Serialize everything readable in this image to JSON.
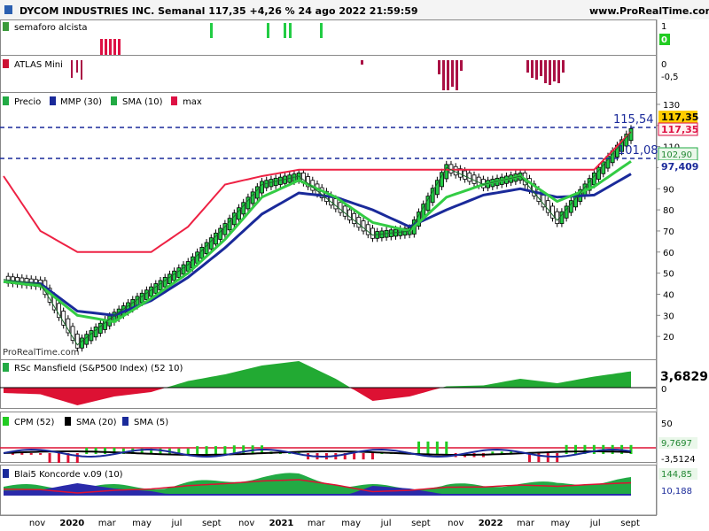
{
  "header": {
    "title": "DYCOM INDUSTRIES INC. Semanal 117,35 +4,26 % 24 ago 2022 21:59:59",
    "site": "www.ProRealTime.com"
  },
  "watermark": "ProRealTime.com",
  "panels": {
    "semaforo": {
      "label": "semaforo alcista",
      "axis": [
        "1",
        "0"
      ],
      "badge": "0"
    },
    "atlas": {
      "label": "ATLAS Mini",
      "axis": [
        "0",
        "-0,5"
      ]
    },
    "price": {
      "legend": [
        {
          "label": "Precio",
          "color": "#22aa44"
        },
        {
          "label": "MMP (30)",
          "color": "#1a2a9a"
        },
        {
          "label": "SMA (10)",
          "color": "#22aa44"
        },
        {
          "label": "max",
          "color": "#dd1144"
        }
      ],
      "annot_high": "115,54",
      "annot_low": "101,08",
      "yticks": [
        "130",
        "120",
        "110",
        "100",
        "90",
        "80",
        "70",
        "60",
        "50",
        "40",
        "30",
        "20"
      ],
      "badges": {
        "price": "117,35",
        "max": "117,35",
        "level": "102,90",
        "mmp": "97,409"
      }
    },
    "rsc": {
      "label": "RSc Mansfield (S&P500 Index) (52 10)",
      "value": "3,6829",
      "axis": [
        "0"
      ]
    },
    "cpm": {
      "legend": [
        {
          "label": "CPM (52)",
          "color": "#22cc22"
        },
        {
          "label": "SMA (20)",
          "color": "#000000"
        },
        {
          "label": "SMA (5)",
          "color": "#1a2a9a"
        }
      ],
      "axis": [
        "50"
      ],
      "badges": [
        "9,7697",
        "-3,5124"
      ]
    },
    "koncorde": {
      "label": "Blai5 Koncorde v.09 (10)",
      "badges": [
        "144,85",
        "10,188"
      ]
    }
  },
  "xaxis": [
    "nov",
    "2020",
    "mar",
    "may",
    "jul",
    "sept",
    "nov",
    "2021",
    "mar",
    "may",
    "jul",
    "sept",
    "nov",
    "2022",
    "mar",
    "may",
    "jul",
    "sept"
  ],
  "chart_data": [
    {
      "type": "line",
      "title": "DYCOM INDUSTRIES INC. Semanal",
      "x": [
        "2019-11",
        "2020-01",
        "2020-03",
        "2020-05",
        "2020-07",
        "2020-09",
        "2020-11",
        "2021-01",
        "2021-03",
        "2021-05",
        "2021-07",
        "2021-09",
        "2021-11",
        "2022-01",
        "2022-03",
        "2022-05",
        "2022-07",
        "2022-08"
      ],
      "series": [
        {
          "name": "Precio",
          "values": [
            47,
            45,
            16,
            30,
            42,
            54,
            72,
            92,
            96,
            82,
            68,
            70,
            100,
            92,
            96,
            75,
            96,
            117
          ]
        },
        {
          "name": "MMP (30)",
          "values": [
            46,
            45,
            32,
            30,
            37,
            48,
            62,
            78,
            88,
            86,
            80,
            72,
            80,
            87,
            90,
            86,
            87,
            97
          ]
        },
        {
          "name": "SMA (10)",
          "values": [
            46,
            44,
            30,
            27,
            38,
            50,
            66,
            86,
            94,
            86,
            74,
            70,
            86,
            92,
            96,
            84,
            91,
            103
          ]
        },
        {
          "name": "max",
          "values": [
            96,
            70,
            60,
            60,
            60,
            72,
            92,
            96,
            99,
            99,
            99,
            99,
            99,
            99,
            99,
            99,
            99,
            117
          ]
        }
      ],
      "ylim": [
        10,
        135
      ],
      "annotations": [
        "115,54",
        "101,08"
      ]
    },
    {
      "type": "area",
      "title": "RSc Mansfield (S&P500 Index) (52 10)",
      "x": [
        "2019-11",
        "2020-01",
        "2020-03",
        "2020-05",
        "2020-07",
        "2020-09",
        "2020-11",
        "2021-01",
        "2021-03",
        "2021-05",
        "2021-07",
        "2021-09",
        "2021-11",
        "2022-01",
        "2022-03",
        "2022-05",
        "2022-07",
        "2022-08"
      ],
      "values": [
        -1.2,
        -1.5,
        -4,
        -2,
        -1,
        1.5,
        3,
        5,
        6,
        2,
        -3,
        -2,
        0.3,
        0.5,
        2,
        1,
        2.5,
        3.68
      ]
    }
  ]
}
